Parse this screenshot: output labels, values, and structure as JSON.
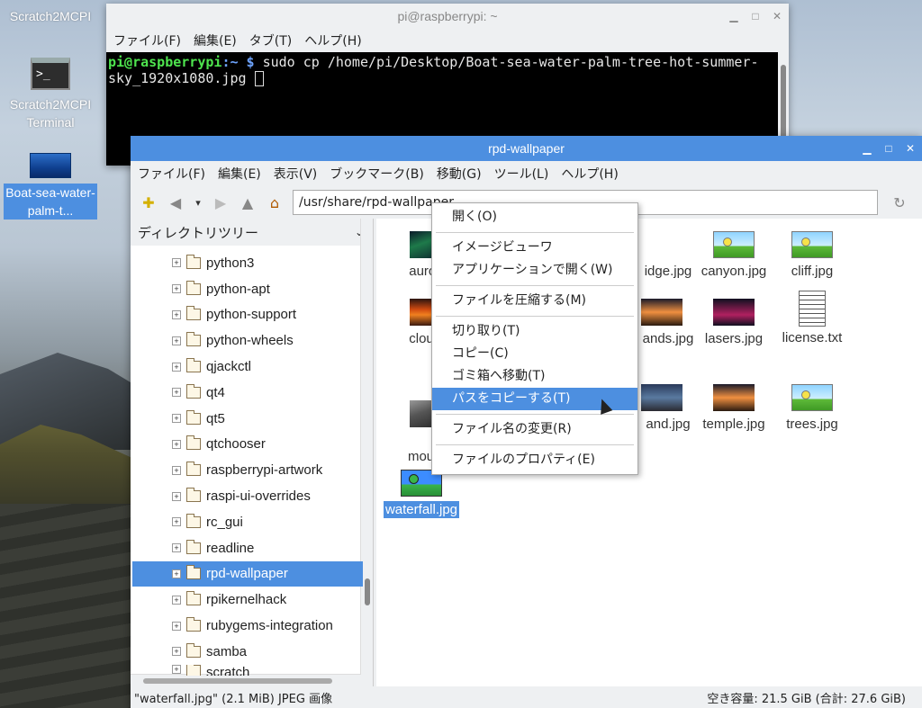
{
  "desktop": {
    "icons": [
      {
        "label": "Scratch2MCPI"
      },
      {
        "label": "Scratch2MCPI Terminal"
      },
      {
        "label": "Boat-sea-water-palm-t..."
      }
    ]
  },
  "terminal": {
    "title": "pi@raspberrypi: ~",
    "menu": [
      "ファイル(F)",
      "編集(E)",
      "タブ(T)",
      "ヘルプ(H)"
    ],
    "prompt_user": "pi@raspberrypi",
    "prompt_path": ":~ $",
    "command": " sudo cp /home/pi/Desktop/Boat-sea-water-palm-tree-hot-summer-sky_1920x1080.jpg "
  },
  "file_manager": {
    "title": "rpd-wallpaper",
    "menu": [
      "ファイル(F)",
      "編集(E)",
      "表示(V)",
      "ブックマーク(B)",
      "移動(G)",
      "ツール(L)",
      "ヘルプ(H)"
    ],
    "path": "/usr/share/rpd-wallpaper",
    "tree_header": "ディレクトリツリー",
    "tree": [
      {
        "label": "python3"
      },
      {
        "label": "python-apt"
      },
      {
        "label": "python-support"
      },
      {
        "label": "python-wheels"
      },
      {
        "label": "qjackctl"
      },
      {
        "label": "qt4"
      },
      {
        "label": "qt5"
      },
      {
        "label": "qtchooser"
      },
      {
        "label": "raspberrypi-artwork"
      },
      {
        "label": "raspi-ui-overrides"
      },
      {
        "label": "rc_gui"
      },
      {
        "label": "readline"
      },
      {
        "label": "rpd-wallpaper",
        "selected": true
      },
      {
        "label": "rpikernelhack"
      },
      {
        "label": "rubygems-integration"
      },
      {
        "label": "samba"
      },
      {
        "label": "scratch"
      }
    ],
    "files": {
      "aurora": "aurora.",
      "bridge": "idge.jpg",
      "canyon": "canyon.jpg",
      "cliff": "cliff.jpg",
      "clouds": "clouds.",
      "sands": "ands.jpg",
      "lasers": "lasers.jpg",
      "license": "license.txt",
      "mountain": "mounta\ng",
      "island": "and.jpg",
      "temple": "temple.jpg",
      "trees": "trees.jpg",
      "waterfall": "waterfall.jpg"
    },
    "status_left": "\"waterfall.jpg\" (2.1 MiB) JPEG 画像",
    "status_right": "空き容量: 21.5 GiB (合計: 27.6 GiB)"
  },
  "context_menu": {
    "open": "開く(O)",
    "image_viewer": "イメージビューワ",
    "open_with": "アプリケーションで開く(W)",
    "compress": "ファイルを圧縮する(M)",
    "cut": "切り取り(T)",
    "copy": "コピー(C)",
    "trash": "ゴミ箱へ移動(T)",
    "copy_path": "パスをコピーする(T)",
    "rename": "ファイル名の変更(R)",
    "properties": "ファイルのプロパティ(E)"
  }
}
